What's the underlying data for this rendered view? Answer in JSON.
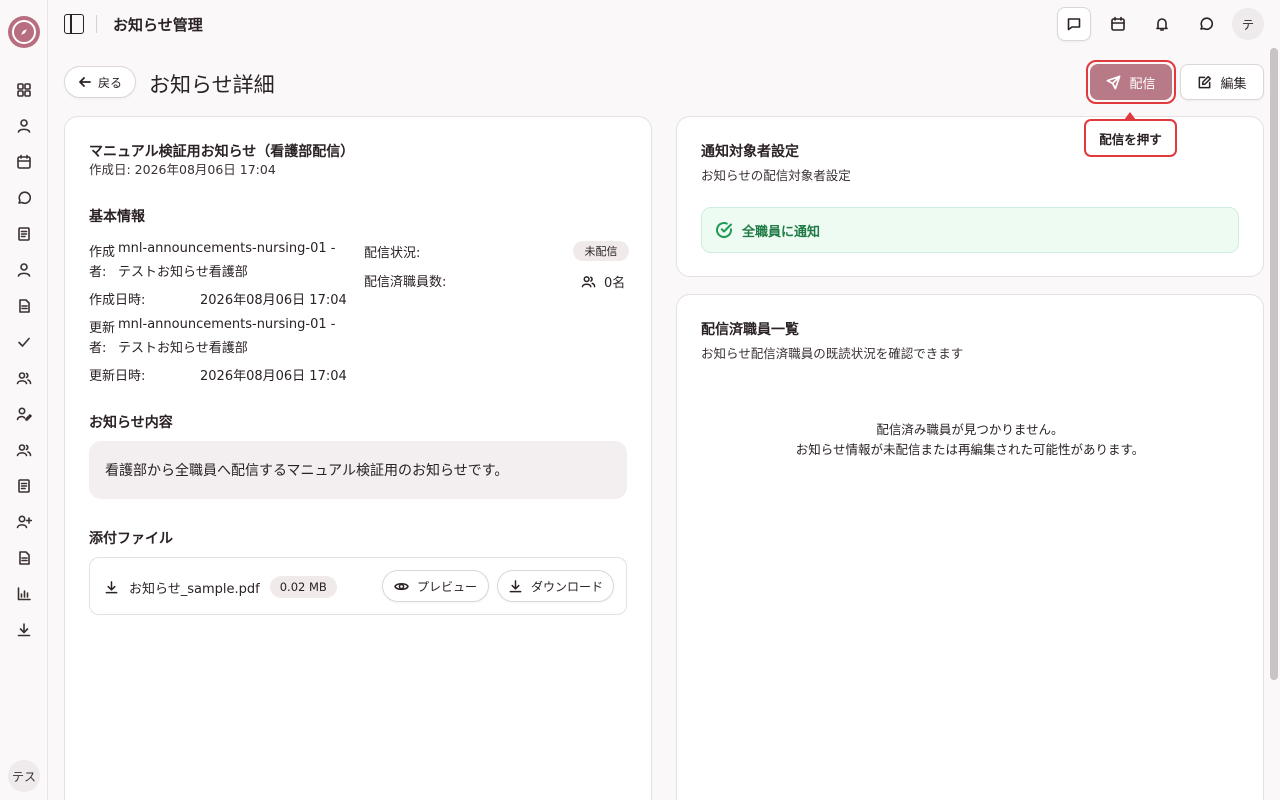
{
  "app": {
    "avatar_initials": "テス"
  },
  "topbar": {
    "title": "お知らせ管理",
    "avatar_initial": "テ"
  },
  "page": {
    "back_label": "戻る",
    "title": "お知らせ詳細",
    "deliver_label": "配信",
    "edit_label": "編集",
    "tooltip": "配信を押す"
  },
  "announcement": {
    "title": "マニュアル検証用お知らせ（看護部配信）",
    "created_line": "作成日: 2026年08月06日 17:04",
    "basic_info_heading": "基本情報",
    "creator_label_1": "作成",
    "creator_label_2": "者:",
    "creator_id": "mnl-announcements-nursing-01 -",
    "creator_name": "テストお知らせ看護部",
    "created_at_label": "作成日時:",
    "created_at_value": "2026年08月06日 17:04",
    "updater_label_1": "更新",
    "updater_label_2": "者:",
    "updater_id": "mnl-announcements-nursing-01 -",
    "updater_name": "テストお知らせ看護部",
    "updated_at_label": "更新日時:",
    "updated_at_value": "2026年08月06日 17:04",
    "status_label": "配信状況:",
    "status_value": "未配信",
    "delivered_count_label": "配信済職員数:",
    "delivered_count_value": "0名",
    "content_heading": "お知らせ内容",
    "content_body": "看護部から全職員へ配信するマニュアル検証用のお知らせです。",
    "attachments_heading": "添付ファイル",
    "file_name": "お知らせ_sample.pdf",
    "file_size": "0.02 MB",
    "preview_label": "プレビュー",
    "download_label": "ダウンロード"
  },
  "target": {
    "heading": "通知対象者設定",
    "subheading": "お知らせの配信対象者設定",
    "notice": "全職員に通知"
  },
  "delivered_list": {
    "heading": "配信済職員一覧",
    "subheading": "お知らせ配信済職員の既読状況を確認できます",
    "empty_line_1": "配信済み職員が見つかりません。",
    "empty_line_2": "お知らせ情報が未配信または再編集された可能性があります。"
  },
  "icons": [
    "compass-logo-icon",
    "dashboard-icon",
    "user-icon",
    "calendar-icon",
    "chat-icon",
    "document-icon",
    "check-icon",
    "users-icon",
    "chart-icon",
    "download-icon",
    "send-icon",
    "edit-icon",
    "eye-icon",
    "bell-icon",
    "check-circle-icon"
  ],
  "colors": {
    "accent": "#b97a88",
    "highlight": "#e0393e",
    "success": "#1f9a55"
  }
}
